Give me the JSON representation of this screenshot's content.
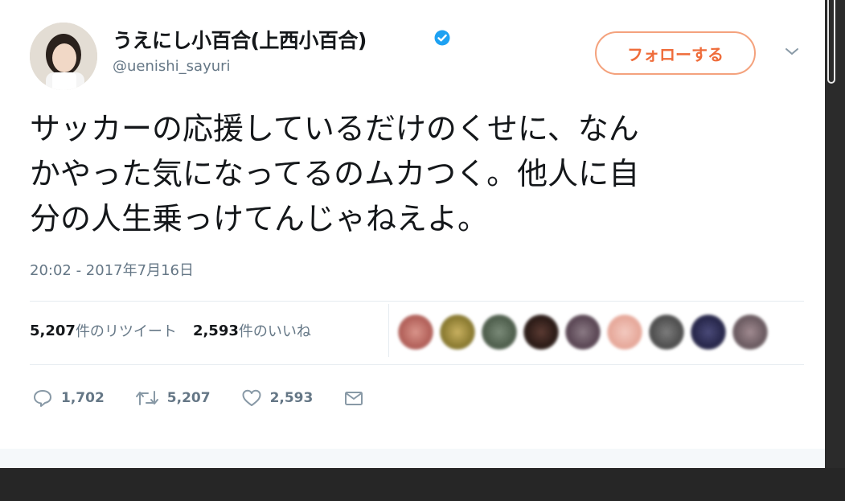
{
  "author": {
    "display_name": "うえにし小百合(上西小百合)",
    "handle": "@uenishi_sayuri",
    "verified": true
  },
  "follow_button": {
    "label": "フォローする"
  },
  "tweet": {
    "lines": [
      "サッカーの応援しているだけのくせに、なん",
      "かやった気になってるのムカつく。他人に自",
      "分の人生乗っけてんじゃねえよ。"
    ],
    "timestamp": "20:02 - 2017年7月16日"
  },
  "stats": {
    "retweets_num": "5,207",
    "retweets_label": "件のリツイート",
    "likes_num": "2,593",
    "likes_label": "件のいいね"
  },
  "actions": {
    "reply_count": "1,702",
    "retweet_count": "5,207",
    "like_count": "2,593"
  },
  "icons": {
    "verified": "verified-badge-icon",
    "menu": "chevron-down-icon",
    "reply": "reply-icon",
    "retweet": "retweet-icon",
    "like": "heart-icon",
    "dm": "envelope-icon"
  },
  "colors": {
    "accent": "#ef6c3a",
    "verified": "#1da1f2",
    "muted_text": "#657786"
  }
}
